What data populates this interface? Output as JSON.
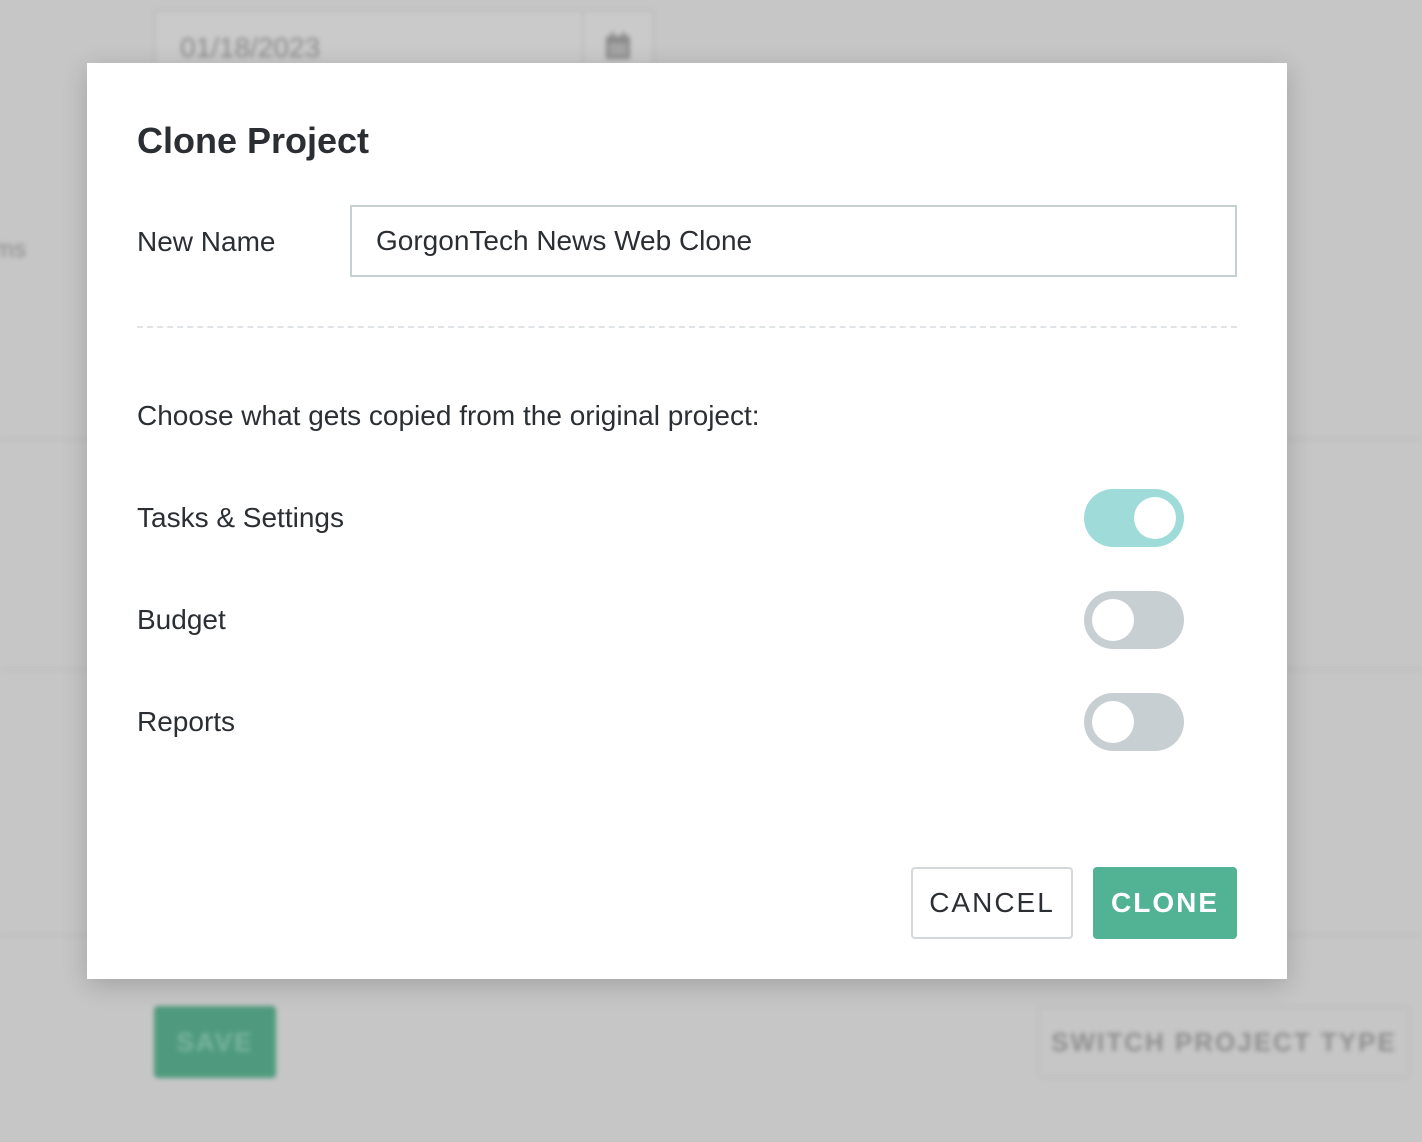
{
  "background": {
    "date_value": "01/18/2023",
    "label_fragment": "ms",
    "save_label": "SAVE",
    "switch_label": "SWITCH PROJECT TYPE"
  },
  "modal": {
    "title": "Clone Project",
    "name_label": "New Name",
    "name_value": "GorgonTech News Web Clone",
    "instruction": "Choose what gets copied from the original project:",
    "options": [
      {
        "label": "Tasks & Settings",
        "enabled": true
      },
      {
        "label": "Budget",
        "enabled": false
      },
      {
        "label": "Reports",
        "enabled": false
      }
    ],
    "cancel_label": "CANCEL",
    "clone_label": "CLONE"
  },
  "colors": {
    "primary": "#52b394",
    "toggle_on": "#9fdbd9",
    "toggle_off": "#c8cfd3",
    "overlay": "#c6c6c6"
  }
}
